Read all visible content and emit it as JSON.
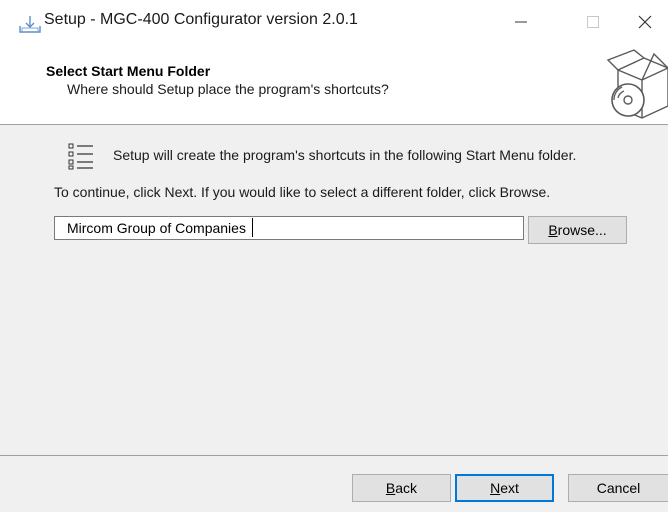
{
  "window": {
    "title": "Setup - MGC-400 Configurator version 2.0.1",
    "app_icon": "installer-icon",
    "controls": [
      "minimize-icon",
      "maximize-icon",
      "close-icon"
    ]
  },
  "header": {
    "title": "Select Start Menu Folder",
    "subtitle": "Where should Setup place the program's shortcuts?",
    "icon": "setup-box-disc-icon"
  },
  "main": {
    "icon": "list-icon",
    "info_text": "Setup will create the program's shortcuts in the following Start Menu folder.",
    "continue_text": "To continue, click Next. If you would like to select a different folder, click Browse.",
    "folder_value": "Mircom Group of Companies",
    "browse": {
      "accel": "B",
      "rest": "rowse..."
    }
  },
  "footer": {
    "back": {
      "accel": "B",
      "rest": "ack"
    },
    "next": {
      "accel": "N",
      "rest": "ext"
    },
    "cancel": "Cancel"
  },
  "colors": {
    "accent": "#0078d7",
    "panel_bg": "#f0f0f0",
    "button_bg": "#e1e1e1"
  }
}
